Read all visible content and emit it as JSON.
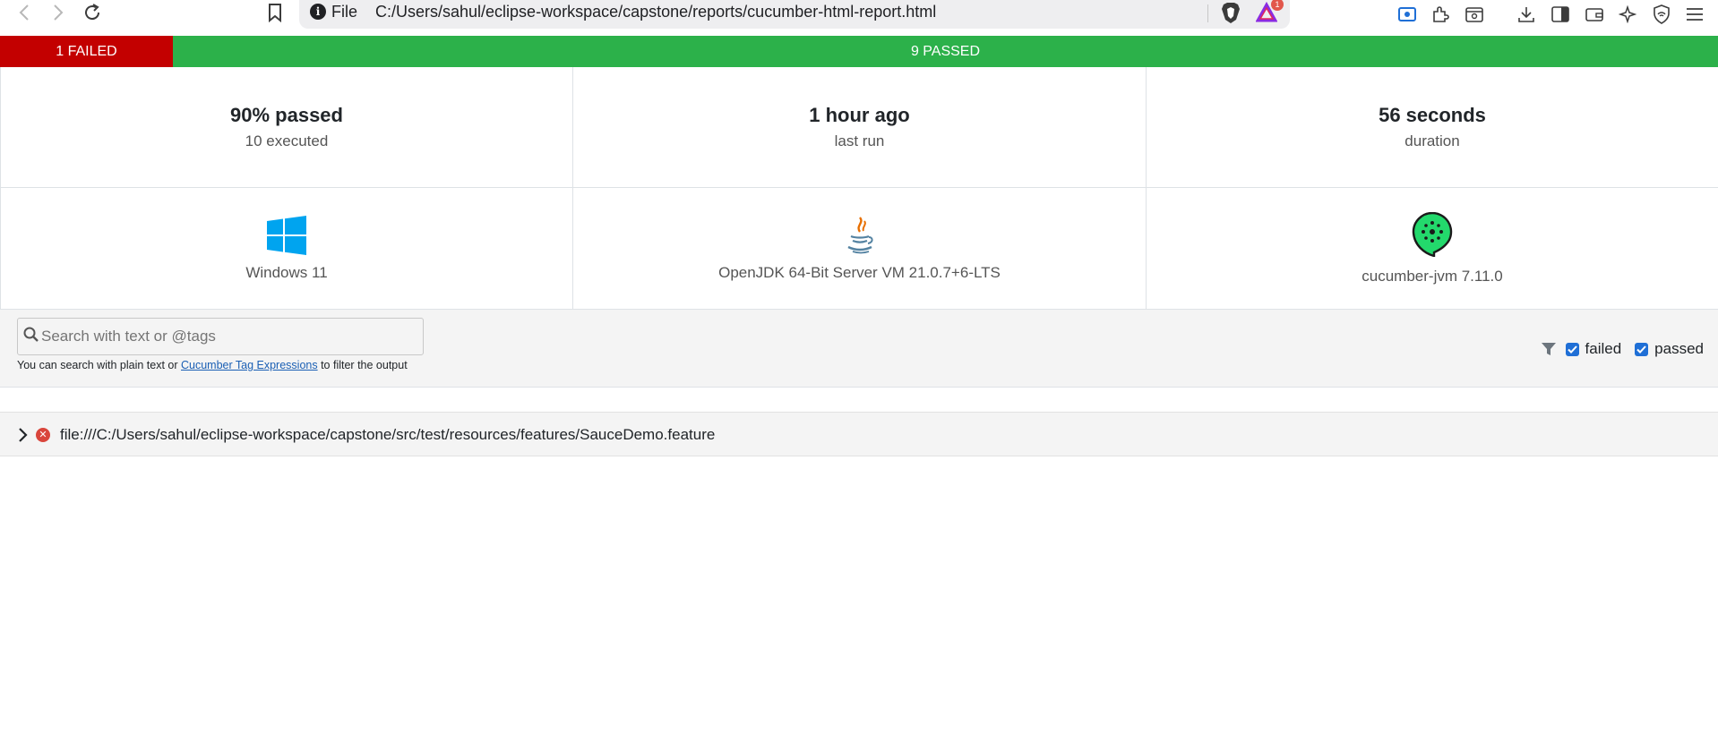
{
  "browser": {
    "address_scheme": "File",
    "address_url": "C:/Users/sahul/eclipse-workspace/capstone/reports/cucumber-html-report.html",
    "rewards_badge_count": "1"
  },
  "status_bar": {
    "failed_label": "1 FAILED",
    "passed_label": "9 PASSED",
    "failed_color": "#c30000",
    "passed_color": "#2cb14a"
  },
  "summary": {
    "passed": {
      "value": "90% passed",
      "label": "10 executed"
    },
    "last_run": {
      "value": "1 hour ago",
      "label": "last run"
    },
    "duration": {
      "value": "56 seconds",
      "label": "duration"
    }
  },
  "environment": {
    "os": {
      "icon": "windows-icon",
      "label": "Windows 11"
    },
    "runtime": {
      "icon": "java-icon",
      "label": "OpenJDK 64-Bit Server VM 21.0.7+6-LTS"
    },
    "implementation": {
      "icon": "cucumber-icon",
      "label": "cucumber-jvm 7.11.0"
    }
  },
  "search": {
    "placeholder": "Search with text or @tags",
    "help_prefix": "You can search with plain text or ",
    "help_link": "Cucumber Tag Expressions",
    "help_suffix": " to filter the output"
  },
  "filters": {
    "items": [
      {
        "label": "failed",
        "checked": true
      },
      {
        "label": "passed",
        "checked": true
      }
    ]
  },
  "features": [
    {
      "status": "failed",
      "uri": "file:///C:/Users/sahul/eclipse-workspace/capstone/src/test/resources/features/SauceDemo.feature"
    }
  ]
}
